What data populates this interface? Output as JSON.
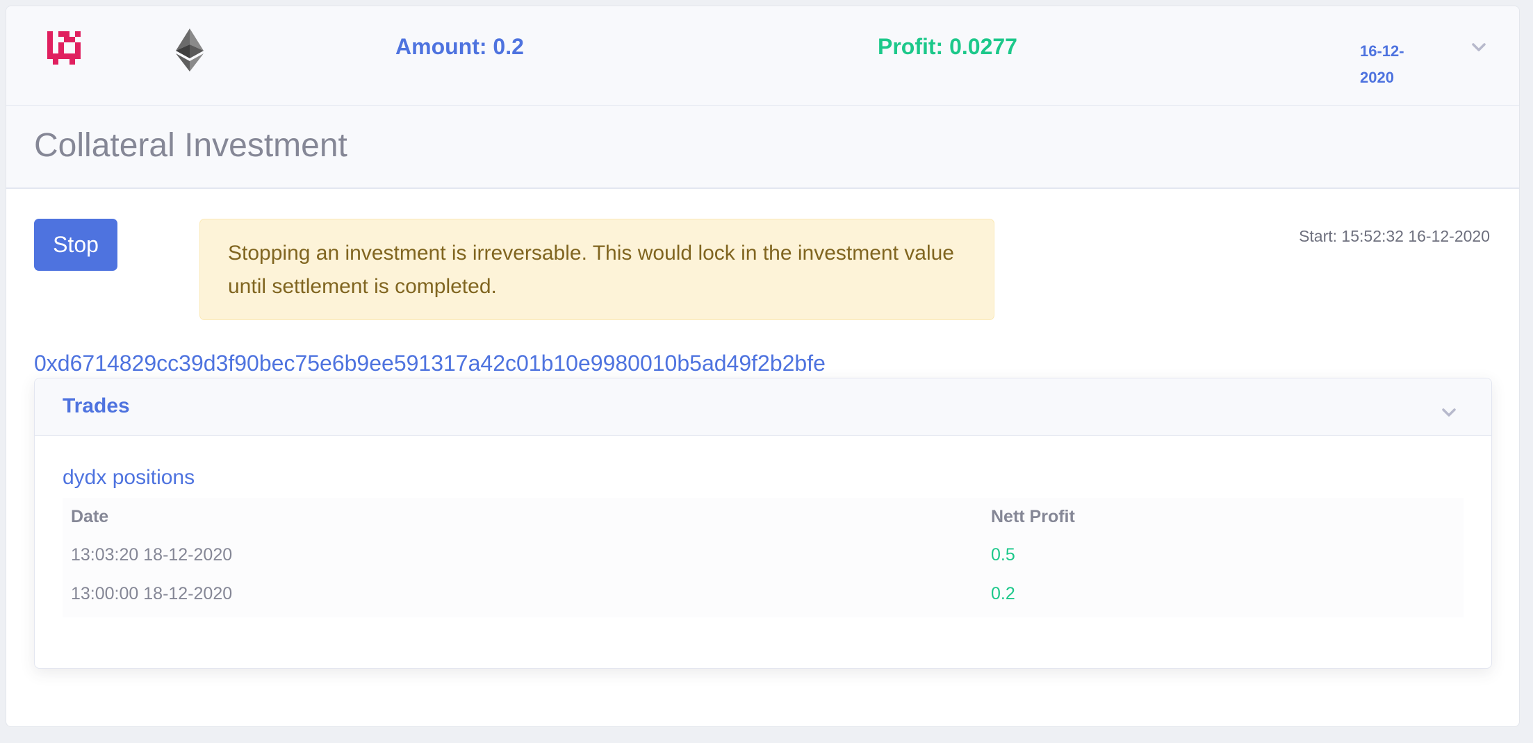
{
  "header": {
    "amount": "Amount: 0.2",
    "profit": "Profit: 0.0277",
    "date_line1": "16-12-",
    "date_line2": "2020",
    "logo_icon": "pixel-logo-icon",
    "asset_icon": "ethereum-icon",
    "expand_icon": "chevron-down-icon"
  },
  "section": {
    "title": "Collateral Investment"
  },
  "actions": {
    "stop_label": "Stop",
    "warning_text": "Stopping an investment is irreversable. This would lock in the investment value until settlement is completed.",
    "start_time": "Start: 15:52:32 16-12-2020"
  },
  "transaction": {
    "hash": "0xd6714829cc39d3f90bec75e6b9ee591317a42c01b10e9980010b5ad49f2b2bfe"
  },
  "trades": {
    "title": "Trades",
    "subtitle": "dydx positions",
    "columns": [
      "Date",
      "Nett Profit"
    ],
    "rows": [
      {
        "date": "13:03:20 18-12-2020",
        "profit": "0.5"
      },
      {
        "date": "13:00:00 18-12-2020",
        "profit": "0.2"
      }
    ]
  },
  "colors": {
    "primary": "#4e73df",
    "success": "#1cc88a",
    "logo": "#e0205f",
    "warning_bg": "#fdf3d8",
    "warning_text": "#806520"
  }
}
